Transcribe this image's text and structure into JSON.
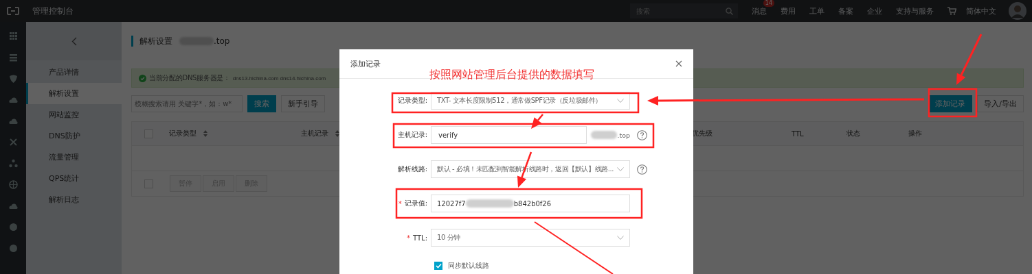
{
  "topbar": {
    "title": "管理控制台",
    "search": {
      "placeholder": "搜索"
    },
    "nav": [
      {
        "label": "消息",
        "badge": "14"
      },
      {
        "label": "费用"
      },
      {
        "label": "工单"
      },
      {
        "label": "备案"
      },
      {
        "label": "企业"
      },
      {
        "label": "支持与服务"
      }
    ],
    "language": "简体中文"
  },
  "subnav": {
    "items": [
      {
        "label": "产品详情",
        "selected": false
      },
      {
        "label": "解析设置",
        "selected": true
      },
      {
        "label": "网站监控",
        "selected": false
      },
      {
        "label": "DNS防护",
        "selected": false
      },
      {
        "label": "流量管理",
        "selected": false
      },
      {
        "label": "QPS统计",
        "selected": false
      },
      {
        "label": "解析日志",
        "selected": false
      }
    ]
  },
  "main": {
    "title": "解析设置",
    "domain_suffix": ".top",
    "notice_label": "当前分配的DNS服务器是：",
    "notice_value": "dns13.hichina.com dns14.hichina.com",
    "search": {
      "placeholder": "模糊搜索请用 关键字*，如：w*"
    },
    "buttons": [
      {
        "label": "搜索",
        "kind": "primary"
      },
      {
        "label": "新手引导",
        "kind": "default"
      }
    ],
    "actions": [
      {
        "label": "添加记录",
        "kind": "primary"
      },
      {
        "label": "导入/导出",
        "kind": "default"
      }
    ],
    "table": {
      "header_checked": false,
      "columns": [
        {
          "label": "记录类型",
          "sortable": true
        },
        {
          "label": "主机记录",
          "sortable": true
        },
        {
          "label": "优先级",
          "sortable": false
        },
        {
          "label": "TTL",
          "sortable": false
        },
        {
          "label": "状态",
          "sortable": false
        },
        {
          "label": "操作",
          "sortable": false
        }
      ],
      "footer_checked": false,
      "footer_buttons": [
        "暂停",
        "启用",
        "删除"
      ]
    }
  },
  "modal": {
    "title": "添加记录",
    "fields": [
      {
        "label": "记录类型:",
        "kind": "select",
        "help": false,
        "value": "TXT- 文本长度限制512，通常做SPF记录（反垃圾邮件）"
      },
      {
        "label": "主机记录:",
        "kind": "input",
        "help": true,
        "value": "verify",
        "suffix": ".top"
      },
      {
        "label": "解析线路:",
        "kind": "select",
        "help": true,
        "value": "默认 - 必填！未匹配到智能解析线路时，返回【默认】线路..."
      },
      {
        "label": "记录值:",
        "kind": "redacted",
        "marker": "*",
        "help": false,
        "value_start": "12027f7",
        "value_end": "b842b0f26"
      },
      {
        "label": "TTL:",
        "kind": "select",
        "marker": "*",
        "help": false,
        "value": "10 分钟"
      }
    ],
    "checkbox": {
      "label": "同步默认线路",
      "checked": true
    }
  },
  "annotation": {
    "text": "按照网站管理后台提供的数据填写"
  }
}
